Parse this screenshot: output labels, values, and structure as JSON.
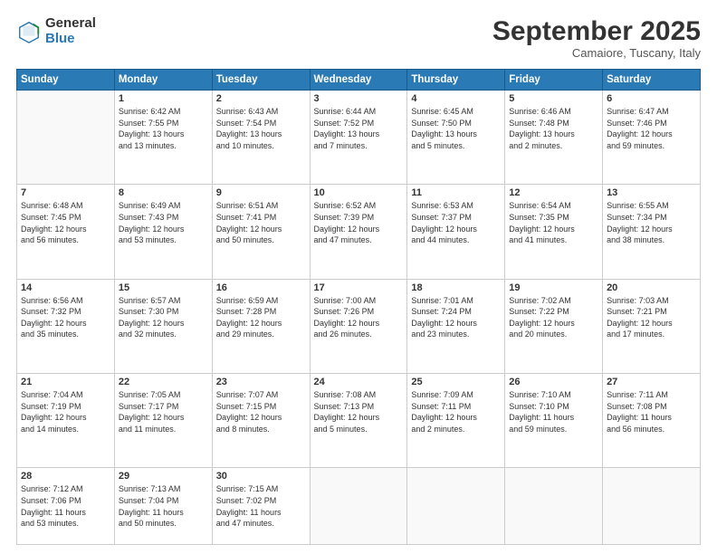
{
  "header": {
    "logo_general": "General",
    "logo_blue": "Blue",
    "month_title": "September 2025",
    "subtitle": "Camaiore, Tuscany, Italy"
  },
  "days_of_week": [
    "Sunday",
    "Monday",
    "Tuesday",
    "Wednesday",
    "Thursday",
    "Friday",
    "Saturday"
  ],
  "weeks": [
    [
      {
        "day": "",
        "lines": []
      },
      {
        "day": "1",
        "lines": [
          "Sunrise: 6:42 AM",
          "Sunset: 7:55 PM",
          "Daylight: 13 hours",
          "and 13 minutes."
        ]
      },
      {
        "day": "2",
        "lines": [
          "Sunrise: 6:43 AM",
          "Sunset: 7:54 PM",
          "Daylight: 13 hours",
          "and 10 minutes."
        ]
      },
      {
        "day": "3",
        "lines": [
          "Sunrise: 6:44 AM",
          "Sunset: 7:52 PM",
          "Daylight: 13 hours",
          "and 7 minutes."
        ]
      },
      {
        "day": "4",
        "lines": [
          "Sunrise: 6:45 AM",
          "Sunset: 7:50 PM",
          "Daylight: 13 hours",
          "and 5 minutes."
        ]
      },
      {
        "day": "5",
        "lines": [
          "Sunrise: 6:46 AM",
          "Sunset: 7:48 PM",
          "Daylight: 13 hours",
          "and 2 minutes."
        ]
      },
      {
        "day": "6",
        "lines": [
          "Sunrise: 6:47 AM",
          "Sunset: 7:46 PM",
          "Daylight: 12 hours",
          "and 59 minutes."
        ]
      }
    ],
    [
      {
        "day": "7",
        "lines": [
          "Sunrise: 6:48 AM",
          "Sunset: 7:45 PM",
          "Daylight: 12 hours",
          "and 56 minutes."
        ]
      },
      {
        "day": "8",
        "lines": [
          "Sunrise: 6:49 AM",
          "Sunset: 7:43 PM",
          "Daylight: 12 hours",
          "and 53 minutes."
        ]
      },
      {
        "day": "9",
        "lines": [
          "Sunrise: 6:51 AM",
          "Sunset: 7:41 PM",
          "Daylight: 12 hours",
          "and 50 minutes."
        ]
      },
      {
        "day": "10",
        "lines": [
          "Sunrise: 6:52 AM",
          "Sunset: 7:39 PM",
          "Daylight: 12 hours",
          "and 47 minutes."
        ]
      },
      {
        "day": "11",
        "lines": [
          "Sunrise: 6:53 AM",
          "Sunset: 7:37 PM",
          "Daylight: 12 hours",
          "and 44 minutes."
        ]
      },
      {
        "day": "12",
        "lines": [
          "Sunrise: 6:54 AM",
          "Sunset: 7:35 PM",
          "Daylight: 12 hours",
          "and 41 minutes."
        ]
      },
      {
        "day": "13",
        "lines": [
          "Sunrise: 6:55 AM",
          "Sunset: 7:34 PM",
          "Daylight: 12 hours",
          "and 38 minutes."
        ]
      }
    ],
    [
      {
        "day": "14",
        "lines": [
          "Sunrise: 6:56 AM",
          "Sunset: 7:32 PM",
          "Daylight: 12 hours",
          "and 35 minutes."
        ]
      },
      {
        "day": "15",
        "lines": [
          "Sunrise: 6:57 AM",
          "Sunset: 7:30 PM",
          "Daylight: 12 hours",
          "and 32 minutes."
        ]
      },
      {
        "day": "16",
        "lines": [
          "Sunrise: 6:59 AM",
          "Sunset: 7:28 PM",
          "Daylight: 12 hours",
          "and 29 minutes."
        ]
      },
      {
        "day": "17",
        "lines": [
          "Sunrise: 7:00 AM",
          "Sunset: 7:26 PM",
          "Daylight: 12 hours",
          "and 26 minutes."
        ]
      },
      {
        "day": "18",
        "lines": [
          "Sunrise: 7:01 AM",
          "Sunset: 7:24 PM",
          "Daylight: 12 hours",
          "and 23 minutes."
        ]
      },
      {
        "day": "19",
        "lines": [
          "Sunrise: 7:02 AM",
          "Sunset: 7:22 PM",
          "Daylight: 12 hours",
          "and 20 minutes."
        ]
      },
      {
        "day": "20",
        "lines": [
          "Sunrise: 7:03 AM",
          "Sunset: 7:21 PM",
          "Daylight: 12 hours",
          "and 17 minutes."
        ]
      }
    ],
    [
      {
        "day": "21",
        "lines": [
          "Sunrise: 7:04 AM",
          "Sunset: 7:19 PM",
          "Daylight: 12 hours",
          "and 14 minutes."
        ]
      },
      {
        "day": "22",
        "lines": [
          "Sunrise: 7:05 AM",
          "Sunset: 7:17 PM",
          "Daylight: 12 hours",
          "and 11 minutes."
        ]
      },
      {
        "day": "23",
        "lines": [
          "Sunrise: 7:07 AM",
          "Sunset: 7:15 PM",
          "Daylight: 12 hours",
          "and 8 minutes."
        ]
      },
      {
        "day": "24",
        "lines": [
          "Sunrise: 7:08 AM",
          "Sunset: 7:13 PM",
          "Daylight: 12 hours",
          "and 5 minutes."
        ]
      },
      {
        "day": "25",
        "lines": [
          "Sunrise: 7:09 AM",
          "Sunset: 7:11 PM",
          "Daylight: 12 hours",
          "and 2 minutes."
        ]
      },
      {
        "day": "26",
        "lines": [
          "Sunrise: 7:10 AM",
          "Sunset: 7:10 PM",
          "Daylight: 11 hours",
          "and 59 minutes."
        ]
      },
      {
        "day": "27",
        "lines": [
          "Sunrise: 7:11 AM",
          "Sunset: 7:08 PM",
          "Daylight: 11 hours",
          "and 56 minutes."
        ]
      }
    ],
    [
      {
        "day": "28",
        "lines": [
          "Sunrise: 7:12 AM",
          "Sunset: 7:06 PM",
          "Daylight: 11 hours",
          "and 53 minutes."
        ]
      },
      {
        "day": "29",
        "lines": [
          "Sunrise: 7:13 AM",
          "Sunset: 7:04 PM",
          "Daylight: 11 hours",
          "and 50 minutes."
        ]
      },
      {
        "day": "30",
        "lines": [
          "Sunrise: 7:15 AM",
          "Sunset: 7:02 PM",
          "Daylight: 11 hours",
          "and 47 minutes."
        ]
      },
      {
        "day": "",
        "lines": []
      },
      {
        "day": "",
        "lines": []
      },
      {
        "day": "",
        "lines": []
      },
      {
        "day": "",
        "lines": []
      }
    ]
  ]
}
